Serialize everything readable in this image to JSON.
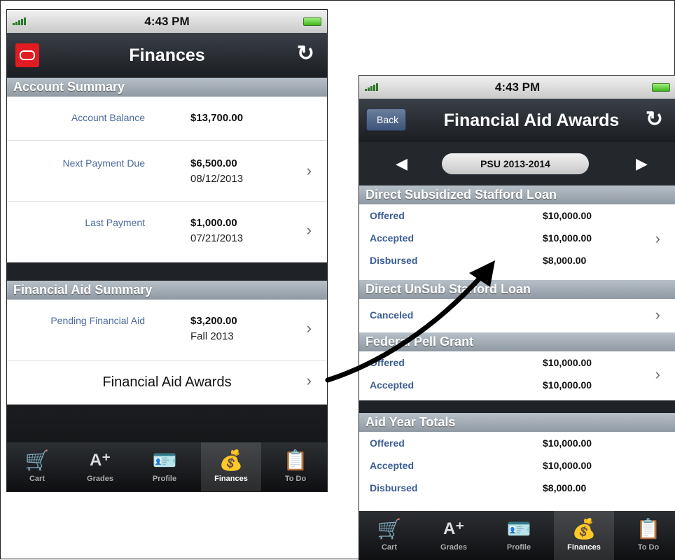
{
  "left_screen": {
    "status_time": "4:43 PM",
    "title": "Finances",
    "account_summary_header": "Account Summary",
    "account_rows": [
      {
        "label": "Account Balance",
        "amount": "$13,700.00",
        "date": ""
      },
      {
        "label": "Next Payment Due",
        "amount": "$6,500.00",
        "date": "08/12/2013"
      },
      {
        "label": "Last Payment",
        "amount": "$1,000.00",
        "date": "07/21/2013"
      }
    ],
    "aid_summary_header": "Financial Aid Summary",
    "aid_row": {
      "label": "Pending Financial Aid",
      "amount": "$3,200.00",
      "term": "Fall 2013"
    },
    "aid_awards_link": "Financial Aid Awards",
    "tabs": [
      {
        "label": "Cart",
        "icon": "cart-icon"
      },
      {
        "label": "Grades",
        "icon": "grades-icon"
      },
      {
        "label": "Profile",
        "icon": "profile-icon"
      },
      {
        "label": "Finances",
        "icon": "finances-icon",
        "active": true
      },
      {
        "label": "To Do",
        "icon": "todo-icon"
      }
    ]
  },
  "right_screen": {
    "status_time": "4:43 PM",
    "back_label": "Back",
    "title": "Financial Aid Awards",
    "aid_year": "PSU 2013-2014",
    "sections": [
      {
        "header": "Direct Subsidized Stafford Loan",
        "rows": [
          {
            "label": "Offered",
            "amount": "$10,000.00"
          },
          {
            "label": "Accepted",
            "amount": "$10,000.00"
          },
          {
            "label": "Disbursed",
            "amount": "$8,000.00"
          }
        ]
      },
      {
        "header": "Direct UnSub Stafford Loan",
        "rows": [
          {
            "label": "Canceled",
            "amount": ""
          }
        ]
      },
      {
        "header": "Federal Pell Grant",
        "rows": [
          {
            "label": "Offered",
            "amount": "$10,000.00"
          },
          {
            "label": "Accepted",
            "amount": "$10,000.00"
          }
        ]
      },
      {
        "header": "Aid Year Totals",
        "rows": [
          {
            "label": "Offered",
            "amount": "$10,000.00"
          },
          {
            "label": "Accepted",
            "amount": "$10,000.00"
          },
          {
            "label": "Disbursed",
            "amount": "$8,000.00"
          }
        ]
      }
    ],
    "tabs": [
      {
        "label": "Cart",
        "icon": "cart-icon"
      },
      {
        "label": "Grades",
        "icon": "grades-icon"
      },
      {
        "label": "Profile",
        "icon": "profile-icon"
      },
      {
        "label": "Finances",
        "icon": "finances-icon",
        "active": true
      },
      {
        "label": "To Do",
        "icon": "todo-icon"
      }
    ]
  },
  "colors": {
    "accent_red": "#e11b22",
    "label_blue": "#4a6a9e",
    "nav_dark": "#1a1d21"
  }
}
